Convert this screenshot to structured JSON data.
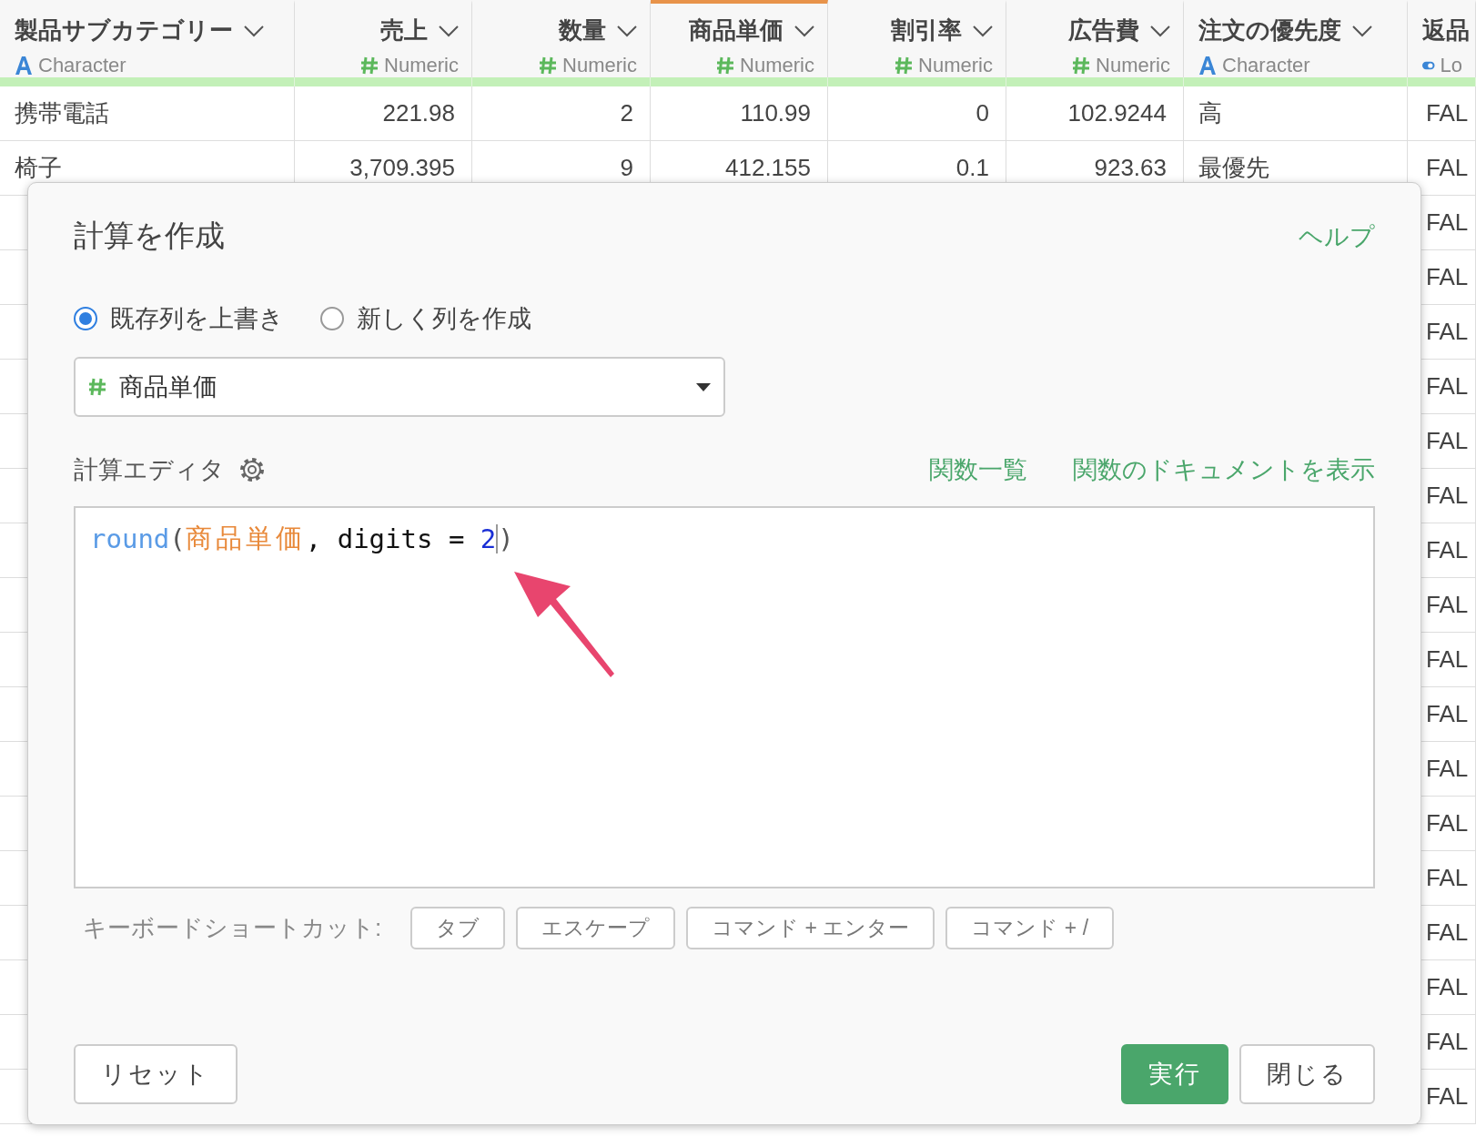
{
  "table": {
    "columns": [
      {
        "name": "製品サブカテゴリー",
        "type": "Character",
        "kind": "character",
        "selected": false
      },
      {
        "name": "売上",
        "type": "Numeric",
        "kind": "numeric",
        "selected": false
      },
      {
        "name": "数量",
        "type": "Numeric",
        "kind": "numeric",
        "selected": false
      },
      {
        "name": "商品単価",
        "type": "Numeric",
        "kind": "numeric",
        "selected": true
      },
      {
        "name": "割引率",
        "type": "Numeric",
        "kind": "numeric",
        "selected": false
      },
      {
        "name": "広告費",
        "type": "Numeric",
        "kind": "numeric",
        "selected": false
      },
      {
        "name": "注文の優先度",
        "type": "Character",
        "kind": "character",
        "selected": false
      },
      {
        "name": "返品",
        "type": "Lo",
        "kind": "logical",
        "selected": false
      }
    ],
    "rows": [
      {
        "cells": [
          "携帯電話",
          "221.98",
          "2",
          "110.99",
          "0",
          "102.9244",
          "高",
          "FAL"
        ]
      },
      {
        "cells": [
          "椅子",
          "3,709.395",
          "9",
          "412.155",
          "0.1",
          "923.63",
          "最優先",
          "FAL"
        ]
      },
      {
        "cells": [
          "FAL"
        ]
      },
      {
        "cells": [
          "FAL"
        ]
      },
      {
        "cells": [
          "FAL"
        ]
      },
      {
        "cells": [
          "FAL"
        ]
      },
      {
        "cells": [
          "FAL"
        ]
      },
      {
        "cells": [
          "FAL"
        ]
      },
      {
        "cells": [
          "FAL"
        ]
      },
      {
        "cells": [
          "FAL"
        ]
      },
      {
        "cells": [
          "FAL"
        ]
      },
      {
        "cells": [
          "FAL"
        ]
      },
      {
        "cells": [
          "FAL"
        ]
      },
      {
        "cells": [
          "FAL"
        ]
      },
      {
        "cells": [
          "FAL"
        ]
      },
      {
        "cells": [
          "FAL"
        ]
      },
      {
        "cells": [
          "FAL"
        ]
      },
      {
        "cells": [
          "FAL"
        ]
      },
      {
        "cells": [
          "FAL"
        ]
      }
    ]
  },
  "dialog": {
    "title": "計算を作成",
    "help_link": "ヘルプ",
    "modes": [
      {
        "label": "既存列を上書き",
        "selected": true
      },
      {
        "label": "新しく列を作成",
        "selected": false
      }
    ],
    "column_select": {
      "value": "商品単価",
      "kind": "numeric"
    },
    "editor_label": "計算エディタ",
    "links": [
      "関数一覧",
      "関数のドキュメントを表示"
    ],
    "code": [
      {
        "kind": "function",
        "text": "round"
      },
      {
        "kind": "paren",
        "text": "("
      },
      {
        "kind": "column",
        "text": "商品単価"
      },
      {
        "kind": "plain",
        "text": ", digits = "
      },
      {
        "kind": "number",
        "text": "2"
      },
      {
        "kind": "cursor"
      },
      {
        "kind": "paren",
        "text": ")"
      }
    ],
    "shortcuts_label": "キーボードショートカット:",
    "shortcuts": [
      "タブ",
      "エスケープ",
      "コマンド + エンター",
      "コマンド + /"
    ],
    "buttons": [
      {
        "label": "リセット",
        "kind": "default"
      },
      {
        "label": "実行",
        "kind": "primary"
      },
      {
        "label": "閉じる",
        "kind": "default"
      }
    ]
  }
}
